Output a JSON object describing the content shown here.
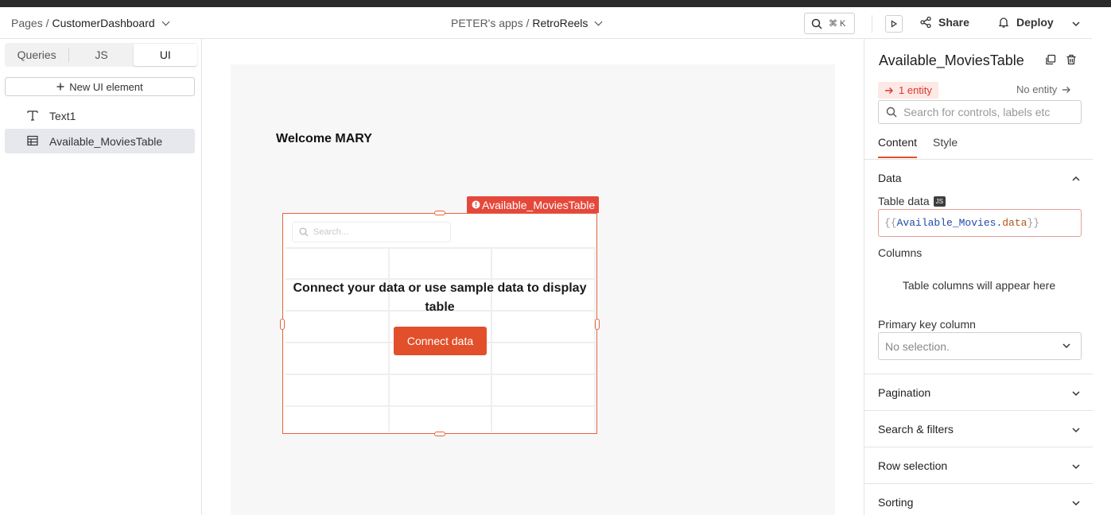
{
  "header": {
    "pages_label": "Pages /",
    "page_name": "CustomerDashboard",
    "workspace": "PETER's apps /",
    "app_name": "RetroReels",
    "search_shortcut": "⌘ K",
    "share_label": "Share",
    "deploy_label": "Deploy"
  },
  "left_panel": {
    "tabs": [
      "Queries",
      "JS",
      "UI"
    ],
    "active_tab": "UI",
    "new_element_label": "New UI element",
    "tree": [
      {
        "label": "Text1",
        "icon": "text-icon"
      },
      {
        "label": "Available_MoviesTable",
        "icon": "table-icon"
      }
    ]
  },
  "canvas": {
    "welcome_text": "Welcome MARY",
    "widget": {
      "label": "Available_MoviesTable",
      "search_placeholder": "Search...",
      "message": "Connect your data or use sample data to display table",
      "button_label": "Connect data"
    }
  },
  "right_panel": {
    "title": "Available_MoviesTable",
    "entity_badge": "1 entity",
    "no_entity": "No entity",
    "search_placeholder": "Search for controls, labels etc",
    "tabs": [
      "Content",
      "Style"
    ],
    "active_tab": "Content",
    "data_section": "Data",
    "table_data_label": "Table data",
    "js_badge": "JS",
    "table_data_value": {
      "open": "{{",
      "object": "Available_Movies",
      "dot": ".",
      "prop": "data",
      "close": "}}"
    },
    "columns_label": "Columns",
    "columns_placeholder": "Table columns will appear here",
    "primary_key_label": "Primary key column",
    "primary_key_value": "No selection.",
    "sections": [
      "Pagination",
      "Search & filters",
      "Row selection",
      "Sorting"
    ]
  },
  "colors": {
    "accent": "#e1502b",
    "widget_label_bg": "#e5483b",
    "error_text": "#d83a2a"
  }
}
